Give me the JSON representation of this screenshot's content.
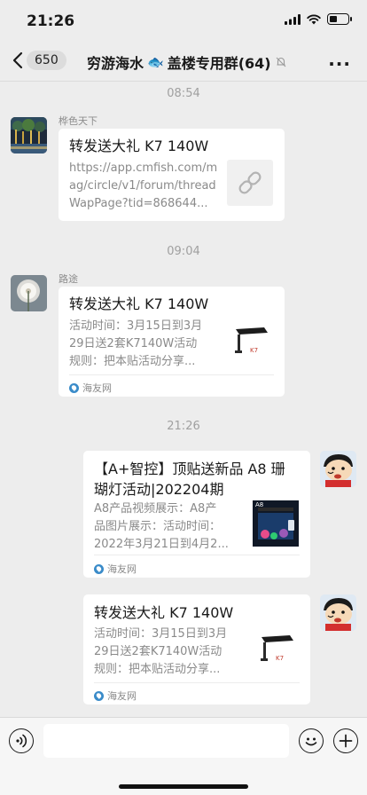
{
  "status_bar": {
    "time": "21:26",
    "battery_level": 0.4
  },
  "nav": {
    "back_badge": "650",
    "title_part1": "穷游海水",
    "title_emoji": "🐟",
    "title_part2": "盖楼专用群(64)"
  },
  "messages": [
    {
      "time": "08:54",
      "sender": "桦色天下",
      "side": "left",
      "card_title": "转发送大礼 K7 140W",
      "card_desc": [
        "https://app.cmfish.com/m",
        "ag/circle/v1/forum/thread",
        "WapPage?tid=868644..."
      ],
      "thumb_icon": "link-icon"
    },
    {
      "time": "09:04",
      "sender": "路途",
      "side": "left",
      "card_title": "转发送大礼 K7 140W",
      "card_desc": [
        "活动时间：3月15日到3月",
        "29日送2套K7140W活动",
        "规则：把本贴活动分享..."
      ],
      "source": "海友网",
      "thumb_icon": "aquarium-light-thumb"
    },
    {
      "time": "21:26",
      "side": "right",
      "card_title": [
        "【A+智控】顶贴送新品 A8 珊",
        "瑚灯活动|202204期"
      ],
      "card_desc": [
        "A8产品视频展示：A8产",
        "品图片展示：活动时间：",
        "2022年3月21日到4月2..."
      ],
      "source": "海友网",
      "thumb_icon": "reef-tank-thumb",
      "thumb_label": "A8"
    },
    {
      "side": "right",
      "card_title": "转发送大礼 K7 140W",
      "card_desc": [
        "活动时间：3月15日到3月",
        "29日送2套K7140W活动",
        "规则：把本贴活动分享..."
      ],
      "source": "海友网",
      "thumb_icon": "aquarium-light-thumb"
    }
  ],
  "colors": {
    "background": "#ededed",
    "card": "#ffffff",
    "muted": "#8a8a8a",
    "source_icon": "#3a8bc9"
  }
}
